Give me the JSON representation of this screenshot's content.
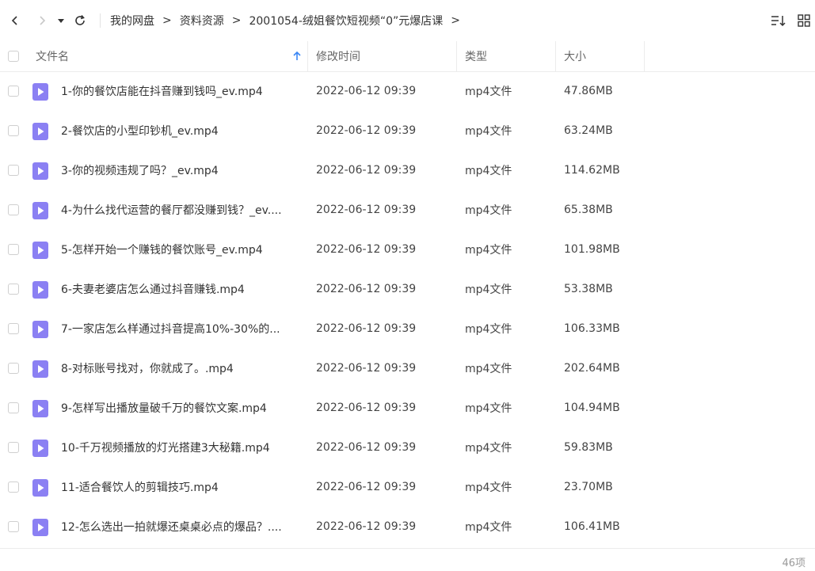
{
  "toolbar": {
    "breadcrumbs": [
      "我的网盘",
      "资料资源",
      "2001054-绒姐餐饮短视频“0”元爆店课"
    ],
    "separator": ">"
  },
  "header": {
    "name": "文件名",
    "mtime": "修改时间",
    "type": "型",
    "type_prefix": "类",
    "size": "大小"
  },
  "files": [
    {
      "name": "1-你的餐饮店能在抖音赚到钱吗_ev.mp4",
      "mtime": "2022-06-12 09:39",
      "type": "mp4文件",
      "size": "47.86MB"
    },
    {
      "name": "2-餐饮店的小型印钞机_ev.mp4",
      "mtime": "2022-06-12 09:39",
      "type": "mp4文件",
      "size": "63.24MB"
    },
    {
      "name": "3-你的视频违规了吗？_ev.mp4",
      "mtime": "2022-06-12 09:39",
      "type": "mp4文件",
      "size": "114.62MB"
    },
    {
      "name": "4-为什么找代运营的餐厅都没赚到钱？_ev....",
      "mtime": "2022-06-12 09:39",
      "type": "mp4文件",
      "size": "65.38MB"
    },
    {
      "name": "5-怎样开始一个赚钱的餐饮账号_ev.mp4",
      "mtime": "2022-06-12 09:39",
      "type": "mp4文件",
      "size": "101.98MB"
    },
    {
      "name": "6-夫妻老婆店怎么通过抖音赚钱.mp4",
      "mtime": "2022-06-12 09:39",
      "type": "mp4文件",
      "size": "53.38MB"
    },
    {
      "name": "7-一家店怎么样通过抖音提高10%-30%的...",
      "mtime": "2022-06-12 09:39",
      "type": "mp4文件",
      "size": "106.33MB"
    },
    {
      "name": "8-对标账号找对，你就成了。.mp4",
      "mtime": "2022-06-12 09:39",
      "type": "mp4文件",
      "size": "202.64MB"
    },
    {
      "name": "9-怎样写出播放量破千万的餐饮文案.mp4",
      "mtime": "2022-06-12 09:39",
      "type": "mp4文件",
      "size": "104.94MB"
    },
    {
      "name": "10-千万视频播放的灯光搭建3大秘籍.mp4",
      "mtime": "2022-06-12 09:39",
      "type": "mp4文件",
      "size": "59.83MB"
    },
    {
      "name": "11-适合餐饮人的剪辑技巧.mp4",
      "mtime": "2022-06-12 09:39",
      "type": "mp4文件",
      "size": "23.70MB"
    },
    {
      "name": "12-怎么选出一拍就爆还桌桌必点的爆品？....",
      "mtime": "2022-06-12 09:39",
      "type": "mp4文件",
      "size": "106.41MB"
    }
  ],
  "footer": {
    "count": "46项"
  },
  "colors": {
    "accent": "#3b87f5",
    "file_icon": "#8b80f3"
  }
}
